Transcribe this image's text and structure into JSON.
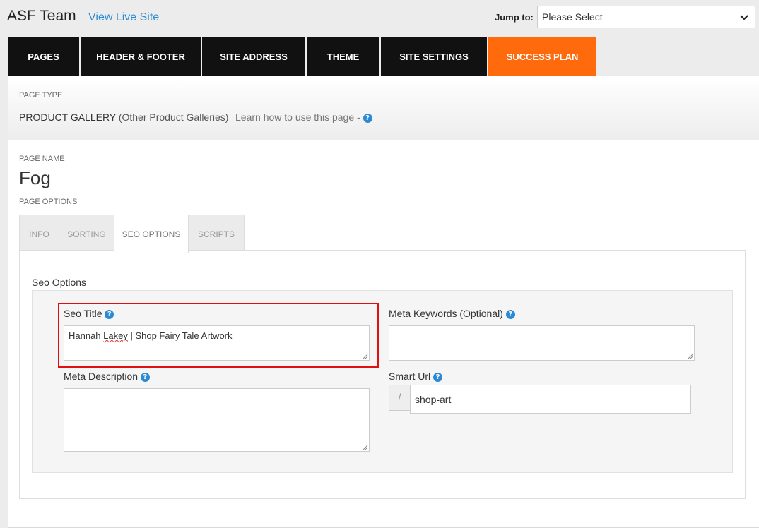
{
  "header": {
    "team_name": "ASF Team",
    "live_link": "View Live Site",
    "jump_label": "Jump to:",
    "jump_value": "Please Select"
  },
  "nav": {
    "items": [
      {
        "label": "PAGES"
      },
      {
        "label": "HEADER & FOOTER"
      },
      {
        "label": "SITE ADDRESS"
      },
      {
        "label": "THEME"
      },
      {
        "label": "SITE SETTINGS"
      },
      {
        "label": "SUCCESS PLAN"
      }
    ]
  },
  "page_type": {
    "label": "PAGE TYPE",
    "value": "PRODUCT GALLERY",
    "sub": "(Other Product Galleries)",
    "learn": "Learn how to use this page -"
  },
  "page_name": {
    "label": "PAGE NAME",
    "value": "Fog"
  },
  "page_options": {
    "label": "PAGE OPTIONS",
    "tabs": [
      {
        "label": "INFO"
      },
      {
        "label": "SORTING"
      },
      {
        "label": "SEO OPTIONS"
      },
      {
        "label": "SCRIPTS"
      }
    ],
    "active_tab": "SEO OPTIONS"
  },
  "seo": {
    "heading": "Seo Options",
    "seo_title_label": "Seo Title",
    "seo_title_value_a": "Hannah ",
    "seo_title_value_b": "Lakey",
    "seo_title_value_c": " | Shop Fairy Tale Artwork",
    "meta_keywords_label": "Meta Keywords (Optional)",
    "meta_keywords_value": "",
    "meta_description_label": "Meta Description",
    "meta_description_value": "",
    "smart_url_label": "Smart Url",
    "smart_url_prefix": "/",
    "smart_url_value": "shop-art"
  },
  "colors": {
    "accent": "#ff6a0c",
    "link": "#2b8ad3",
    "highlight": "#e01010"
  }
}
